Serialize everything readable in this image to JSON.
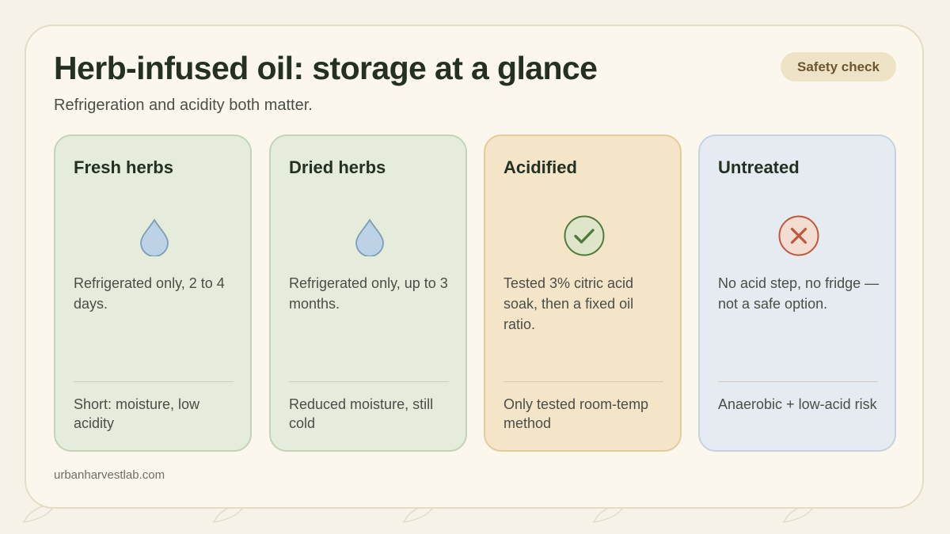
{
  "header": {
    "title": "Herb-infused oil: storage at a glance",
    "subtitle": "Refrigeration and acidity both matter.",
    "badge": "Safety check"
  },
  "cards": [
    {
      "title": "Fresh herbs",
      "icon": "water-drop-icon",
      "text": "Refrigerated only, 2 to 4 days.",
      "note": "Short: moisture, low acidity"
    },
    {
      "title": "Dried herbs",
      "icon": "water-drop-icon",
      "text": "Refrigerated only, up to 3 months.",
      "note": "Reduced moisture, still cold"
    },
    {
      "title": "Acidified",
      "icon": "check-circle-icon",
      "text": "Tested 3% citric acid soak, then a fixed oil ratio.",
      "note": "Only tested room-temp method"
    },
    {
      "title": "Untreated",
      "icon": "x-circle-icon",
      "text": "No acid step, no fridge — not a safe option.",
      "note": "Anaerobic + low-acid risk"
    }
  ],
  "footer": {
    "source": "urbanharvestlab.com"
  },
  "colors": {
    "background": "#f6f2e8",
    "panel": "#fbf7ec",
    "card_green": "#e5ecdb",
    "card_amber": "#f4e5c9",
    "card_blue": "#e5ebf1",
    "drop": "#bcd3e5",
    "check": "#4e7a3c",
    "cross": "#c0573b",
    "badge": "#efe3c7"
  }
}
